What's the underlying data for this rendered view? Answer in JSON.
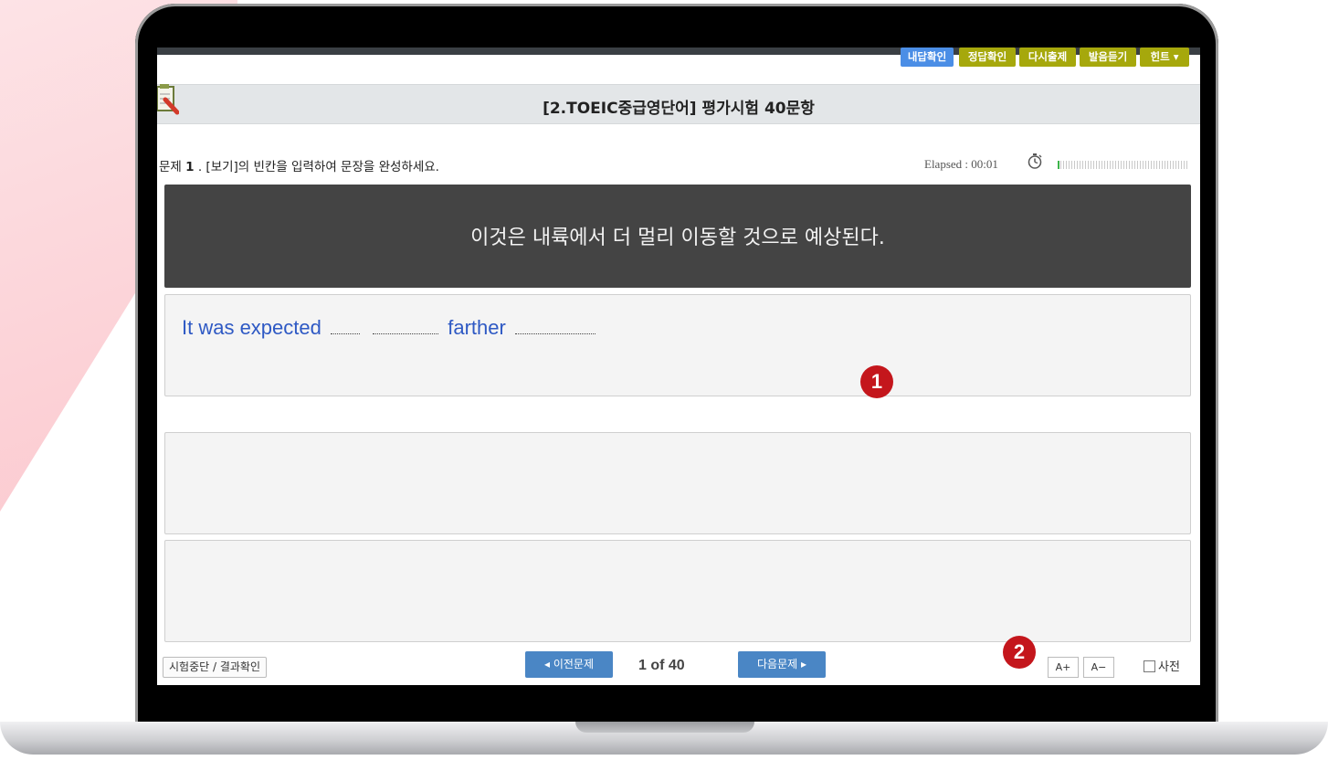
{
  "title": "[2.TOEIC중급영단어] 평가시험 40문항",
  "question": {
    "prefix": "문제 ",
    "number": "1",
    "instruction": " . [보기]의 빈칸을 입력하여 문장을 완성하세요."
  },
  "timer": {
    "elapsed_label": "Elapsed : 00:01",
    "icon": "stopwatch-icon",
    "progress_fraction": 0.01
  },
  "prompt_text": "이것은 내륙에서 더 멀리 이동할 것으로 예상된다.",
  "sentence": {
    "part1": "It was expected",
    "part2": "farther",
    "color": "#2e59c4"
  },
  "markers": [
    "1",
    "2"
  ],
  "actions": {
    "my_answer": "내답확인",
    "correct_answer": "정답확인",
    "retry": "다시출제",
    "listen": "발음듣기",
    "hint": "힌트 ▾"
  },
  "footer": {
    "stop": "시험중단 / 결과확인",
    "prev": "◂ 이전문제",
    "page": "1 of 40",
    "next": "다음문제 ▸",
    "font_up": "A+",
    "font_down": "A−",
    "dictionary": "사전"
  },
  "colors": {
    "accent_blue": "#4b8ee6",
    "olive": "#a6a80c",
    "nav_blue": "#4a86c5",
    "marker_red": "#c4161c"
  }
}
